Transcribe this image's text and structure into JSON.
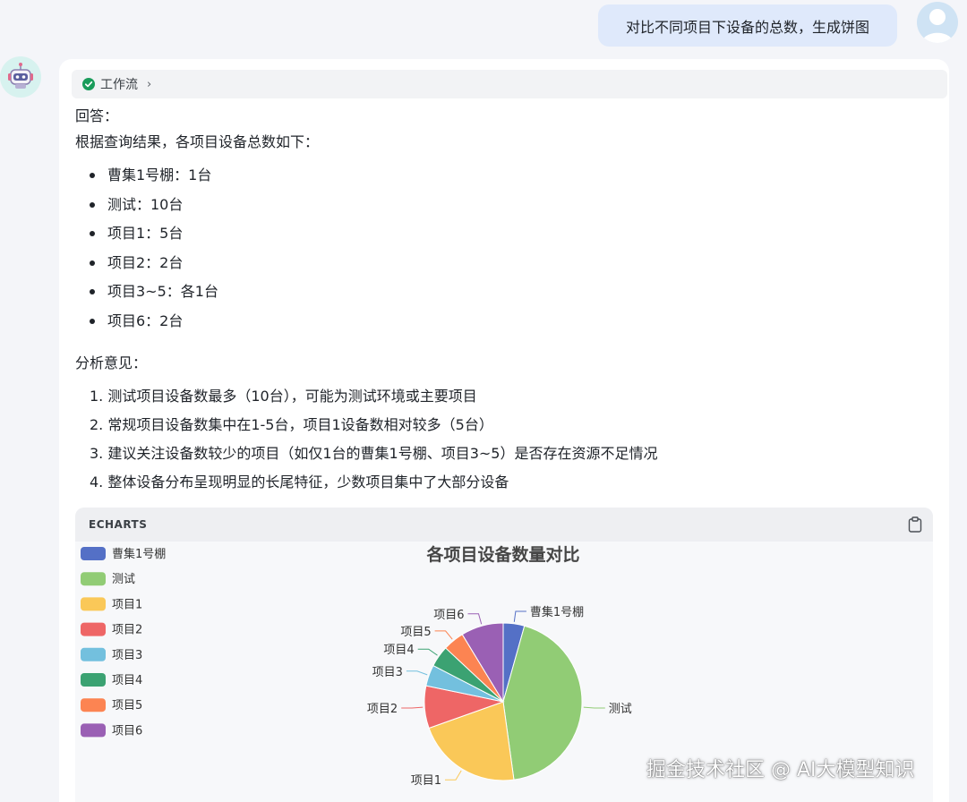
{
  "user_message": "对比不同项目下设备的总数，生成饼图",
  "workflow": {
    "label": "工作流"
  },
  "answer": {
    "heading": "回答：",
    "intro": "根据查询结果，各项目设备总数如下：",
    "bullets": [
      "曹集1号棚：1台",
      "测试：10台",
      "项目1：5台",
      "项目2：2台",
      "项目3~5：各1台",
      "项目6：2台"
    ],
    "analysis_heading": "分析意见：",
    "analysis": [
      "1. 测试项目设备数最多（10台），可能为测试环境或主要项目",
      "2. 常规项目设备数集中在1-5台，项目1设备数相对较多（5台）",
      "3. 建议关注设备数较少的项目（如仅1台的曹集1号棚、项目3~5）是否存在资源不足情况",
      "4. 整体设备分布呈现明显的长尾特征，少数项目集中了大部分设备"
    ]
  },
  "echarts_label": "ECHARTS",
  "chart_data": {
    "type": "pie",
    "title": "各项目设备数量对比",
    "legend_position": "top-left",
    "categories": [
      "曹集1号棚",
      "测试",
      "项目1",
      "项目2",
      "项目3",
      "项目4",
      "项目5",
      "项目6"
    ],
    "values": [
      1,
      10,
      5,
      2,
      1,
      1,
      1,
      2
    ],
    "colors": [
      "#5470c6",
      "#91cc75",
      "#fac858",
      "#ee6666",
      "#73c0de",
      "#3ba272",
      "#fc8452",
      "#9a60b4"
    ]
  },
  "watermark": "掘金技术社区 @ AI大模型知识"
}
